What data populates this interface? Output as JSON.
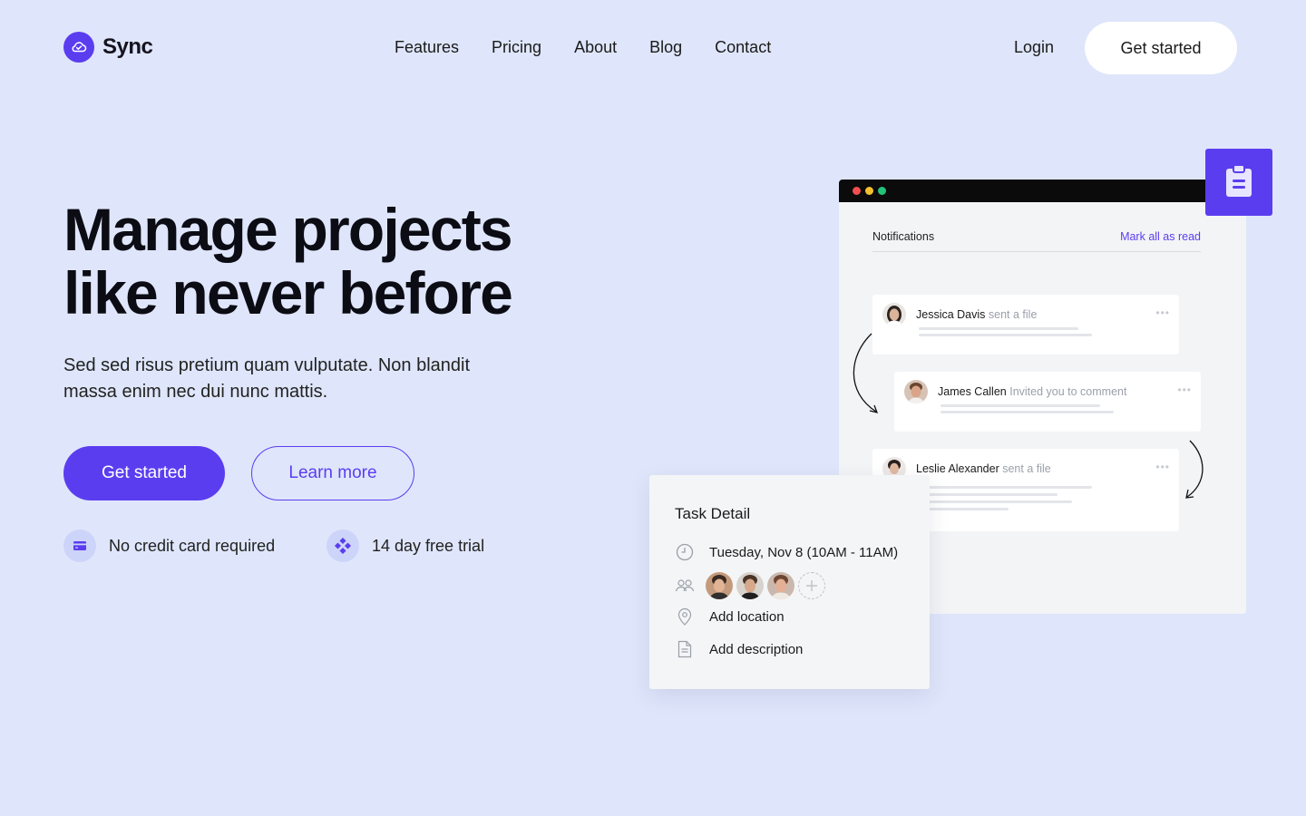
{
  "brand": {
    "name": "Sync",
    "icon": "cloud-check-icon",
    "accent": "#5b3df0"
  },
  "nav": {
    "items": [
      {
        "label": "Features"
      },
      {
        "label": "Pricing"
      },
      {
        "label": "About"
      },
      {
        "label": "Blog"
      },
      {
        "label": "Contact"
      }
    ]
  },
  "header": {
    "login_label": "Login",
    "cta_label": "Get started"
  },
  "hero": {
    "title_line1": "Manage projects",
    "title_line2": "like never before",
    "subtitle": "Sed sed risus pretium quam vulputate. Non blandit massa enim nec dui nunc mattis.",
    "primary_label": "Get started",
    "secondary_label": "Learn more",
    "perks": [
      {
        "label": "No credit card required",
        "icon": "credit-card-icon"
      },
      {
        "label": "14 day free trial",
        "icon": "diamond-grid-icon"
      }
    ]
  },
  "notifications": {
    "title": "Notifications",
    "mark_all_label": "Mark all as read",
    "items": [
      {
        "name": "Jessica Davis",
        "action": "sent a file",
        "more": "•••"
      },
      {
        "name": "James Callen",
        "action": "Invited you to comment",
        "more": "•••"
      },
      {
        "name": "Leslie Alexander",
        "action": "sent a file",
        "more": "•••"
      }
    ]
  },
  "task_detail": {
    "title": "Task Detail",
    "date": "Tuesday, Nov 8 (10AM - 11AM)",
    "location_label": "Add location",
    "description_label": "Add description",
    "add_member_icon": "plus-icon"
  }
}
